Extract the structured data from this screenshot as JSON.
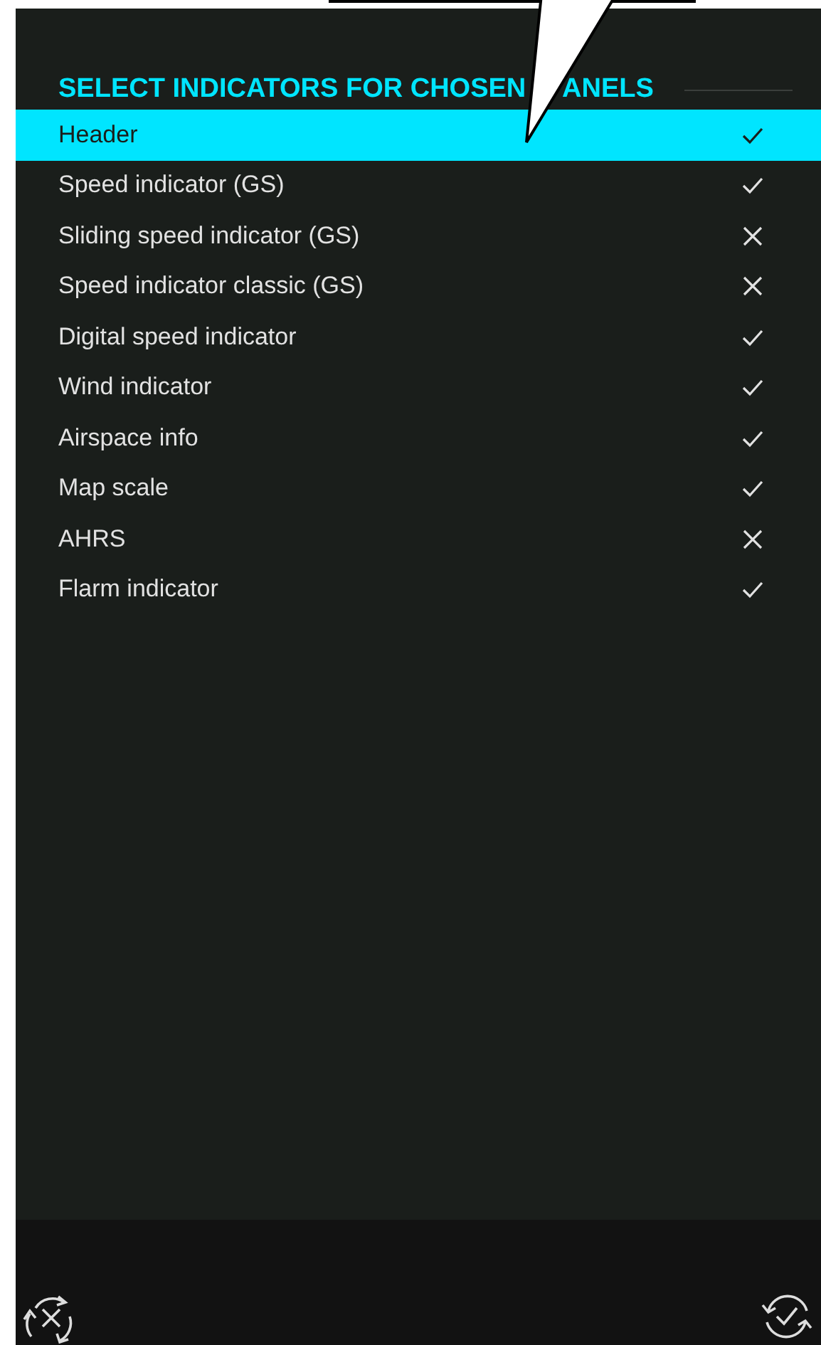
{
  "title_parts": [
    "SELECT INDICATORS FOR CHOSEN",
    "ANELS"
  ],
  "items": [
    {
      "label": "Header",
      "checked": true,
      "selected": true
    },
    {
      "label": "Speed indicator (GS)",
      "checked": true,
      "selected": false
    },
    {
      "label": "Sliding speed indicator (GS)",
      "checked": false,
      "selected": false
    },
    {
      "label": "Speed indicator classic (GS)",
      "checked": false,
      "selected": false
    },
    {
      "label": "Digital speed indicator",
      "checked": true,
      "selected": false
    },
    {
      "label": "Wind indicator",
      "checked": true,
      "selected": false
    },
    {
      "label": "Airspace info",
      "checked": true,
      "selected": false
    },
    {
      "label": "Map scale",
      "checked": true,
      "selected": false
    },
    {
      "label": "AHRS",
      "checked": false,
      "selected": false
    },
    {
      "label": "Flarm indicator",
      "checked": true,
      "selected": false
    }
  ]
}
